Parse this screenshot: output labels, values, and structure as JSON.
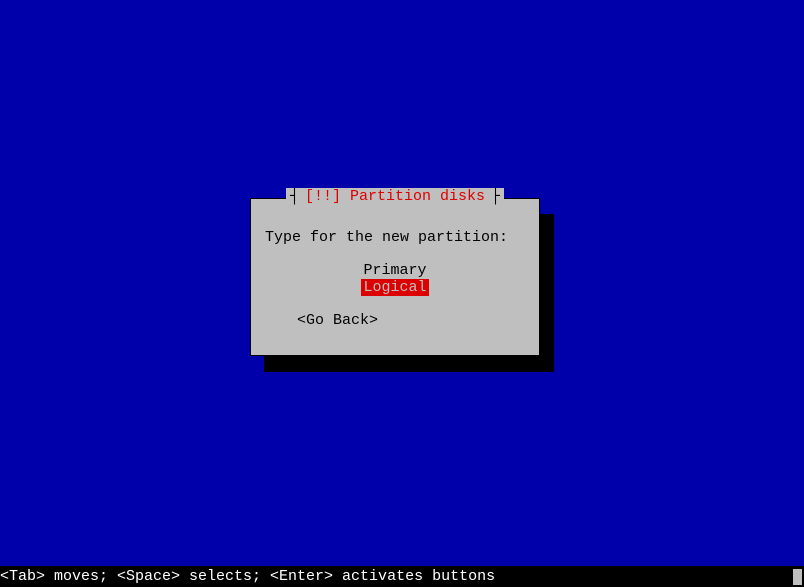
{
  "dialog": {
    "title_marker": "[!!]",
    "title": "Partition disks",
    "prompt": "Type for the new partition:",
    "options": {
      "primary": "Primary",
      "logical": "Logical"
    },
    "go_back": "<Go Back>"
  },
  "help_bar": "<Tab> moves; <Space> selects; <Enter> activates buttons"
}
